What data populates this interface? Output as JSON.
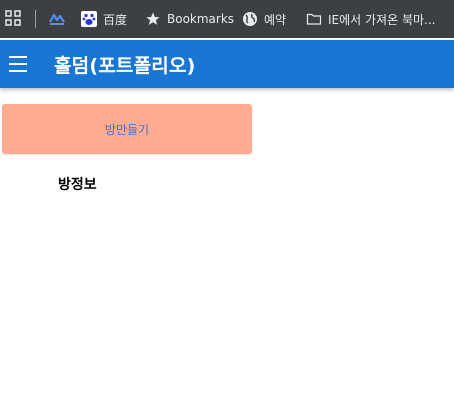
{
  "bookmarks_bar": {
    "items": [
      {
        "label": "",
        "icon": "google-news-icon"
      },
      {
        "label": "百度",
        "icon": "baidu-paw-icon"
      },
      {
        "label": "Bookmarks",
        "icon": "star-icon"
      },
      {
        "label": "예약",
        "icon": "globe-icon"
      },
      {
        "label": "IE에서 가져온 북마...",
        "icon": "folder-icon"
      }
    ]
  },
  "app_bar": {
    "title": "홀덤(포트폴리오)",
    "color": "#1976d2"
  },
  "main": {
    "create_room_label": "방만들기",
    "create_room_color": "#ffab91",
    "room_info_label": "방정보"
  }
}
